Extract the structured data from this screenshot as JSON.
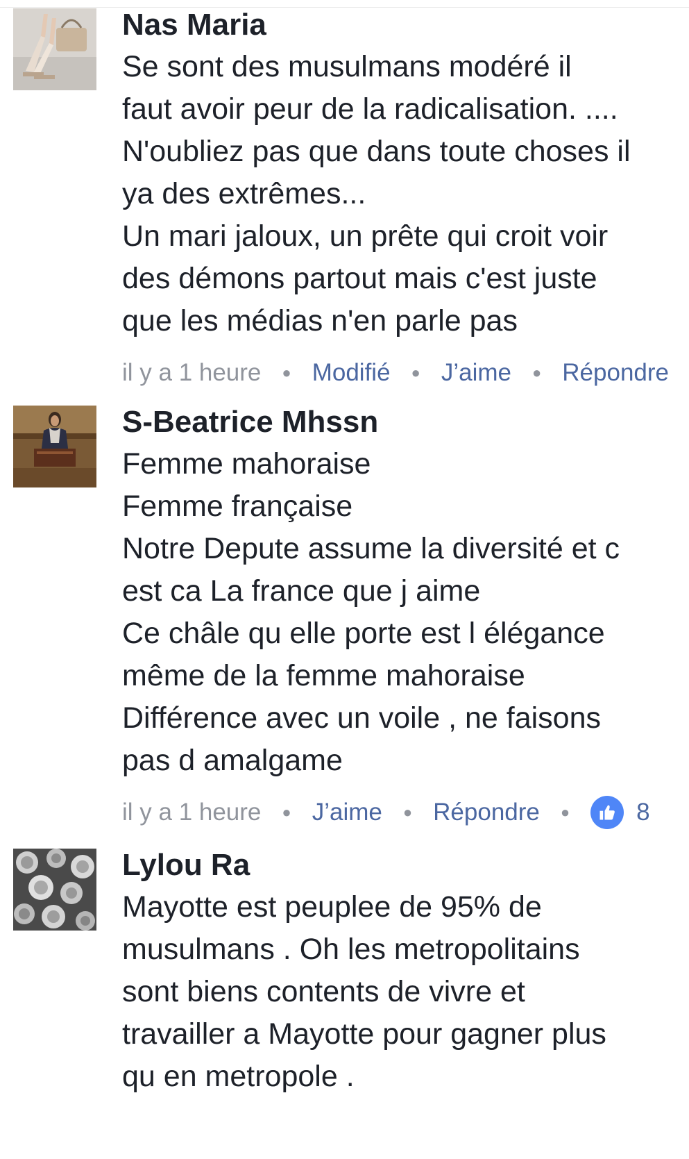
{
  "comments": [
    {
      "author": "Nas Maria",
      "lines": [
        "Se sont des musulmans modéré  il",
        "faut avoir peur de la radicalisation. ....",
        "N'oubliez pas que dans toute choses il",
        "ya des extrêmes...",
        "Un mari jaloux, un prête qui croit voir",
        "des démons partout mais c'est juste",
        "que les médias n'en parle pas"
      ],
      "time": "il y a 1 heure",
      "edited_label": "Modifié",
      "like_label": "J’aime",
      "reply_label": "Répondre",
      "avatar_icon": "photo-avatar-shoes"
    },
    {
      "author": "S-Beatrice Mhssn",
      "lines": [
        "Femme mahoraise",
        "Femme française",
        "Notre Depute assume la diversité et c",
        "est ca La france que j aime",
        "Ce châle qu elle porte est l élégance",
        "même de la femme mahoraise",
        "Différence avec un voile ,  ne faisons",
        "pas d amalgame"
      ],
      "time": "il y a 1 heure",
      "like_label": "J’aime",
      "reply_label": "Répondre",
      "reaction_count": "8",
      "reaction_icon": "thumbs-up-icon",
      "avatar_icon": "photo-avatar-podium"
    },
    {
      "author": "Lylou Ra",
      "lines": [
        "Mayotte est peuplee de 95% de",
        "musulmans . Oh les metropolitains",
        "sont biens contents de vivre et",
        "travailler a Mayotte pour gagner plus",
        "qu en metropole ."
      ],
      "avatar_icon": "photo-avatar-roses"
    }
  ],
  "colors": {
    "author": "#1d2129",
    "body": "#1d2129",
    "meta_gray": "#90949c",
    "action_blue": "#4b67a1",
    "like_badge": "#4f86f7"
  }
}
